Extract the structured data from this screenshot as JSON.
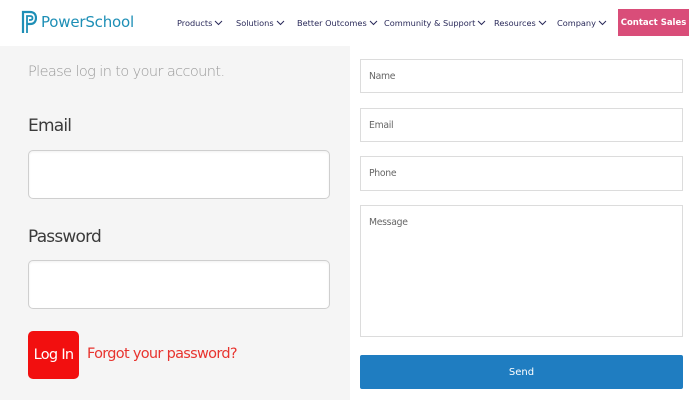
{
  "header": {
    "logo_text": "PowerSchool",
    "nav": [
      {
        "label": "Products"
      },
      {
        "label": "Solutions"
      },
      {
        "label": "Better Outcomes"
      },
      {
        "label": "Community & Support"
      },
      {
        "label": "Resources"
      },
      {
        "label": "Company"
      }
    ],
    "cta_label": "Contact Sales"
  },
  "login": {
    "prompt": "Please log in to your account.",
    "email_label": "Email",
    "password_label": "Password",
    "login_button": "Log In",
    "forgot_link": "Forgot your password?"
  },
  "contact": {
    "name_placeholder": "Name",
    "email_placeholder": "Email",
    "phone_placeholder": "Phone",
    "message_placeholder": "Message",
    "send_button": "Send"
  },
  "colors": {
    "brand": "#1e8fb6",
    "cta": "#d94d79",
    "login_button": "#f20f0f",
    "forgot_link": "#e8342f",
    "send_button": "#1f7dc1"
  },
  "icons": [
    "powerschool-logo-icon",
    "chevron-down-icon"
  ]
}
